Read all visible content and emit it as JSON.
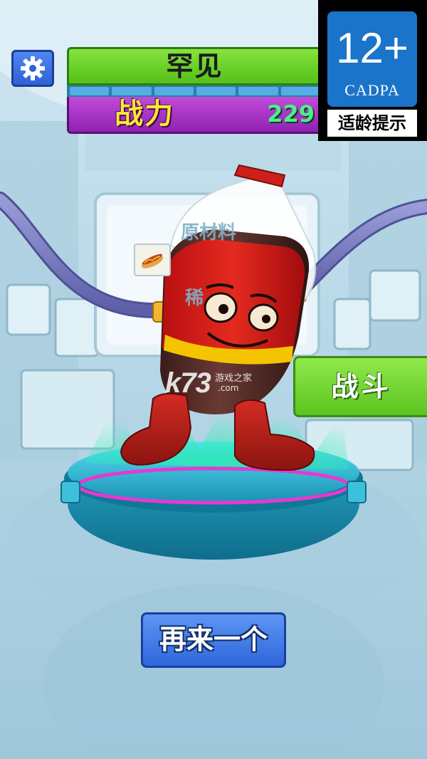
{
  "header": {
    "rarity_label": "罕见",
    "power_label": "战力",
    "power_value": "229",
    "progress_segments": 6
  },
  "age_rating": {
    "age": "12+",
    "org": "CADPA",
    "note": "适龄提示"
  },
  "machine_screen": {
    "title": "原材料",
    "partial_text": "稀",
    "material_icon": "hotdog-icon"
  },
  "actions": {
    "fight_label": "战斗",
    "again_label": "再来一个"
  },
  "watermark": {
    "logo": "k73",
    "name": "游戏之家",
    "url": ".com"
  },
  "colors": {
    "rarity_green": "#66cf24",
    "power_purple": "#a934c4",
    "power_value_green": "#4cf08a",
    "button_blue": "#3a72e2",
    "fight_green": "#6fd131",
    "cadpa_blue": "#1a74c9"
  }
}
